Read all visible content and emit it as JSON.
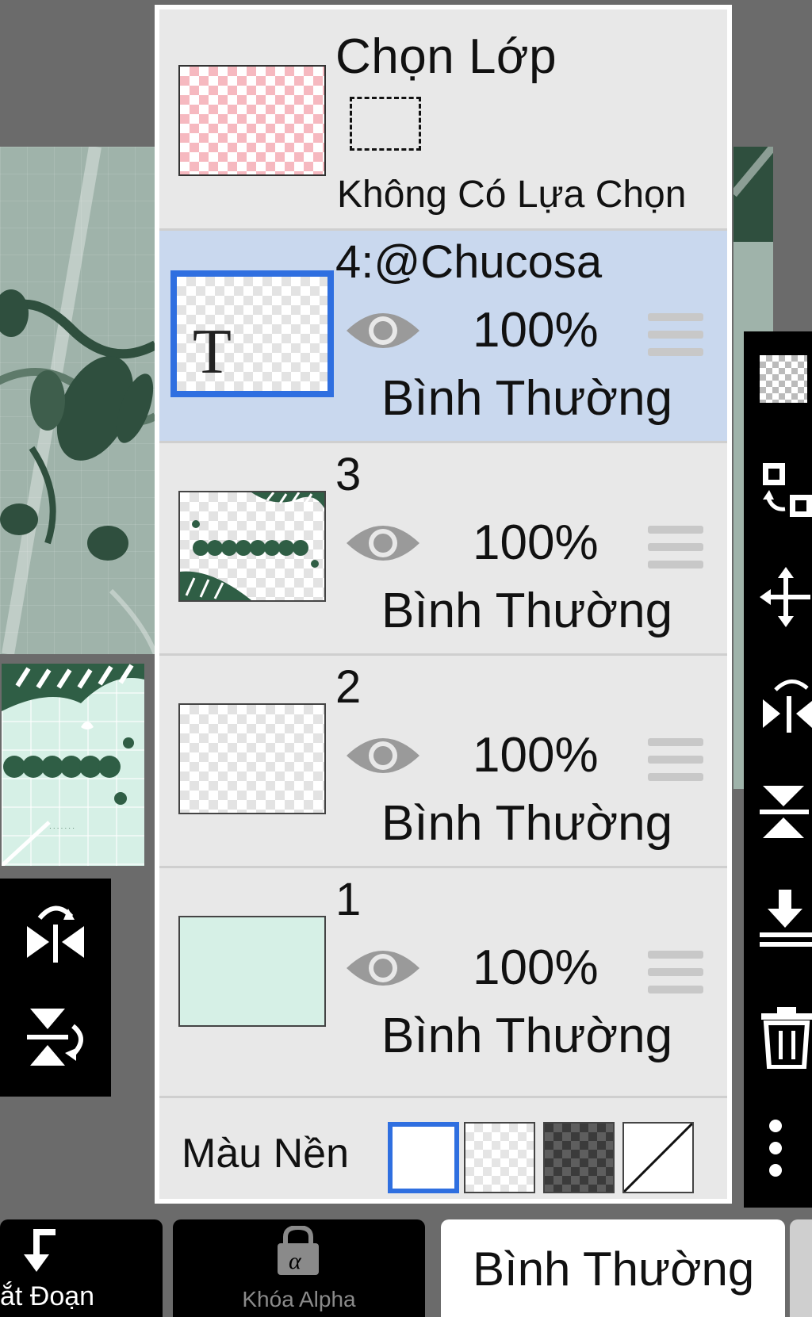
{
  "panel": {
    "title": "Chọn Lớp",
    "selection_note": "Không Có Lựa Chọn"
  },
  "layers": [
    {
      "name": "4:@Chucosa",
      "opacity": "100%",
      "blend": "Bình Thường",
      "selected": true,
      "thumb_glyph": "T",
      "visible": true
    },
    {
      "name": "3",
      "opacity": "100%",
      "blend": "Bình Thường",
      "selected": false,
      "visible": true
    },
    {
      "name": "2",
      "opacity": "100%",
      "blend": "Bình Thường",
      "selected": false,
      "visible": true
    },
    {
      "name": "1",
      "opacity": "100%",
      "blend": "Bình Thường",
      "selected": false,
      "visible": true
    }
  ],
  "background": {
    "label": "Màu Nền",
    "options": [
      "white",
      "transparent-light",
      "transparent-dark",
      "none"
    ],
    "selected": "white"
  },
  "bottom_bar": {
    "clip_label": "ắt Đoạn",
    "alpha_lock_label": "Khóa Alpha",
    "blend_mode_label": "Bình Thường"
  },
  "icons": {
    "eye": "eye-icon",
    "handle": "drag-handle-icon",
    "alpha_lock": "lock-alpha-icon"
  },
  "colors": {
    "accent": "#2f6fe0",
    "active_row": "#c9d8ee",
    "panel": "#e8e8e8",
    "toolbar": "#000000"
  }
}
